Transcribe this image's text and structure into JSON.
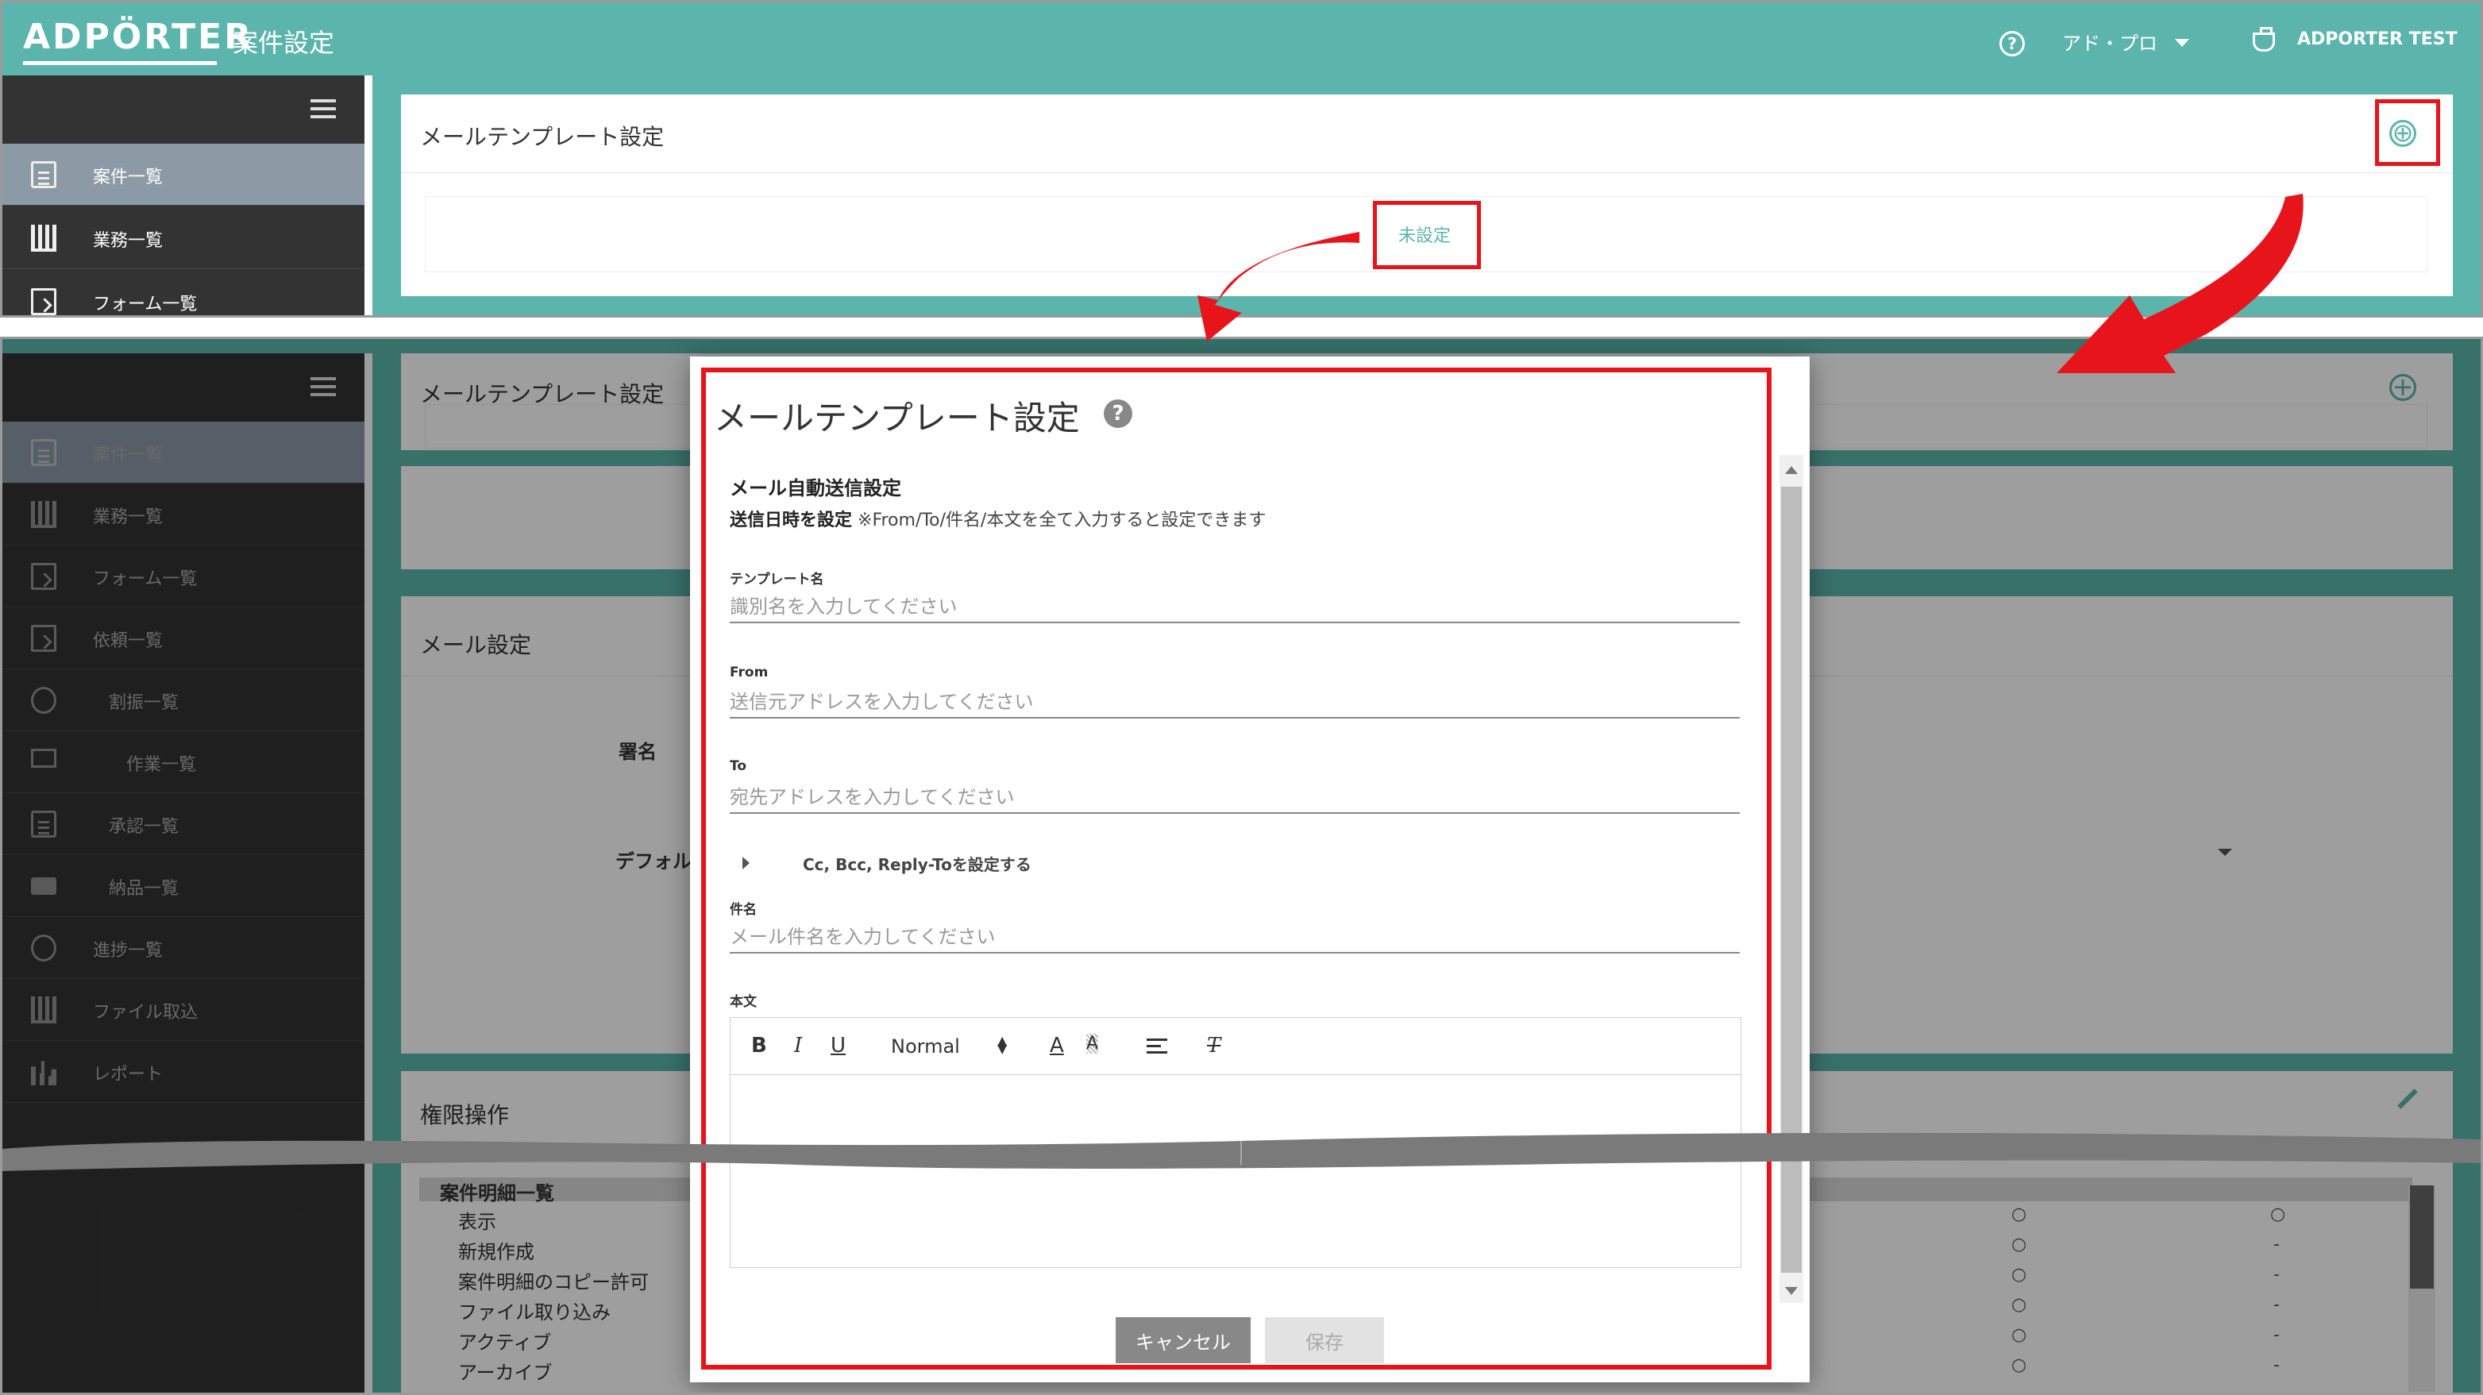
{
  "header": {
    "logo": "ADPÖRTER",
    "page_title": "案件設定",
    "help_icon": "?",
    "project": "アド・プロ",
    "user": "ADPORTER TEST"
  },
  "sidebar_top": [
    {
      "label": "案件一覧",
      "icon": "document-icon",
      "active": true
    },
    {
      "label": "業務一覧",
      "icon": "building-icon"
    },
    {
      "label": "フォーム一覧",
      "icon": "form-icon"
    }
  ],
  "top_card": {
    "title": "メールテンプレート設定",
    "add_icon": "⊕",
    "unset_link": "未設定"
  },
  "sidebar_bottom": [
    {
      "label": "案件一覧"
    },
    {
      "label": "業務一覧"
    },
    {
      "label": "フォーム一覧"
    },
    {
      "label": "依頼一覧"
    },
    {
      "label": "割振一覧"
    },
    {
      "label": "作業一覧"
    },
    {
      "label": "承認一覧"
    },
    {
      "label": "納品一覧"
    },
    {
      "label": "進捗一覧"
    },
    {
      "label": "ファイル取込"
    },
    {
      "label": "レポート"
    }
  ],
  "background": {
    "card1_title": "メールテンプレート設定",
    "card2_title": "メール設定",
    "signature_label": "署名",
    "default_label": "デフォル",
    "card3_title": "権限操作",
    "perm_header": "案件明細一覧",
    "perm_rows": [
      {
        "label": "表示",
        "c1": "○",
        "c2": "○"
      },
      {
        "label": "新規作成",
        "c1": "○",
        "c2": "-"
      },
      {
        "label": "案件明細のコピー許可",
        "c1": "○",
        "c2": "-"
      },
      {
        "label": "ファイル取り込み",
        "c1": "○",
        "c2": "-"
      },
      {
        "label": "アクティブ",
        "c1": "○",
        "c2": "-"
      },
      {
        "label": "アーカイブ",
        "c1": "○",
        "c2": "-"
      }
    ]
  },
  "modal": {
    "title": "メールテンプレート設定",
    "help": "?",
    "section_title": "メール自動送信設定",
    "note_bold": "送信日時を設定",
    "note_rest": " ※From/To/件名/本文を全て入力すると設定できます",
    "template_name_label": "テンプレート名",
    "template_name_placeholder": "識別名を入力してください",
    "from_label": "From",
    "from_placeholder": "送信元アドレスを入力してください",
    "to_label": "To",
    "to_placeholder": "宛先アドレスを入力してください",
    "cc_toggle": "Cc, Bcc, Reply-Toを設定する",
    "subject_label": "件名",
    "subject_placeholder": "メール件名を入力してください",
    "body_label": "本文",
    "toolbar": {
      "bold": "B",
      "italic": "I",
      "underline": "U",
      "size": "Normal",
      "color": "A",
      "bg": "A",
      "clear": "T"
    },
    "cancel": "キャンセル",
    "save": "保存"
  },
  "colors": {
    "teal": "#5bb5ac",
    "sidebar": "#333333",
    "highlight": "#e8141c"
  }
}
